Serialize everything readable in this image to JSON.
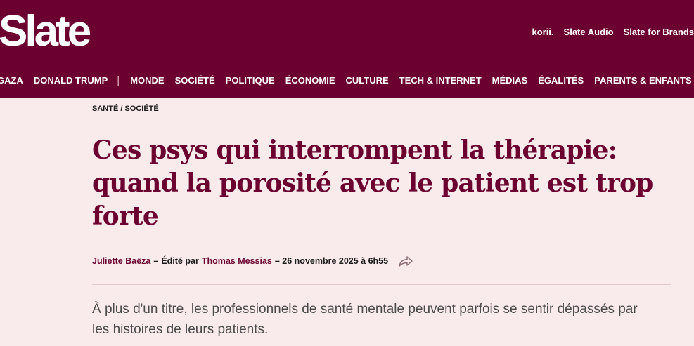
{
  "header": {
    "logo": "Slate",
    "top_links": [
      "korii.",
      "Slate Audio",
      "Slate for Brands"
    ]
  },
  "nav": {
    "items_before": [
      "GAZA",
      "DONALD TRUMP"
    ],
    "separator": "|",
    "items_after": [
      "MONDE",
      "SOCIÉTÉ",
      "POLITIQUE",
      "ÉCONOMIE",
      "CULTURE",
      "TECH & INTERNET",
      "MÉDIAS",
      "ÉGALITÉS",
      "PARENTS & ENFANTS"
    ]
  },
  "article": {
    "kicker": "SANTÉ / SOCIÉTÉ",
    "headline": "Ces psys qui interrompent la thérapie: quand la porosité avec le patient est trop forte",
    "author": "Juliette Baëza",
    "dash": "–",
    "edited_by": "Édité par",
    "editor": "Thomas Messias",
    "date": "– 26 novembre 2025 à 6h55",
    "share_icon": "share-arrow-icon",
    "lede": "À plus d'un titre, les professionnels de santé mentale peuvent parfois se sentir dépassés par les histoires de leurs patients."
  },
  "colors": {
    "brand": "#6b0030",
    "background": "#f9ebeb"
  }
}
